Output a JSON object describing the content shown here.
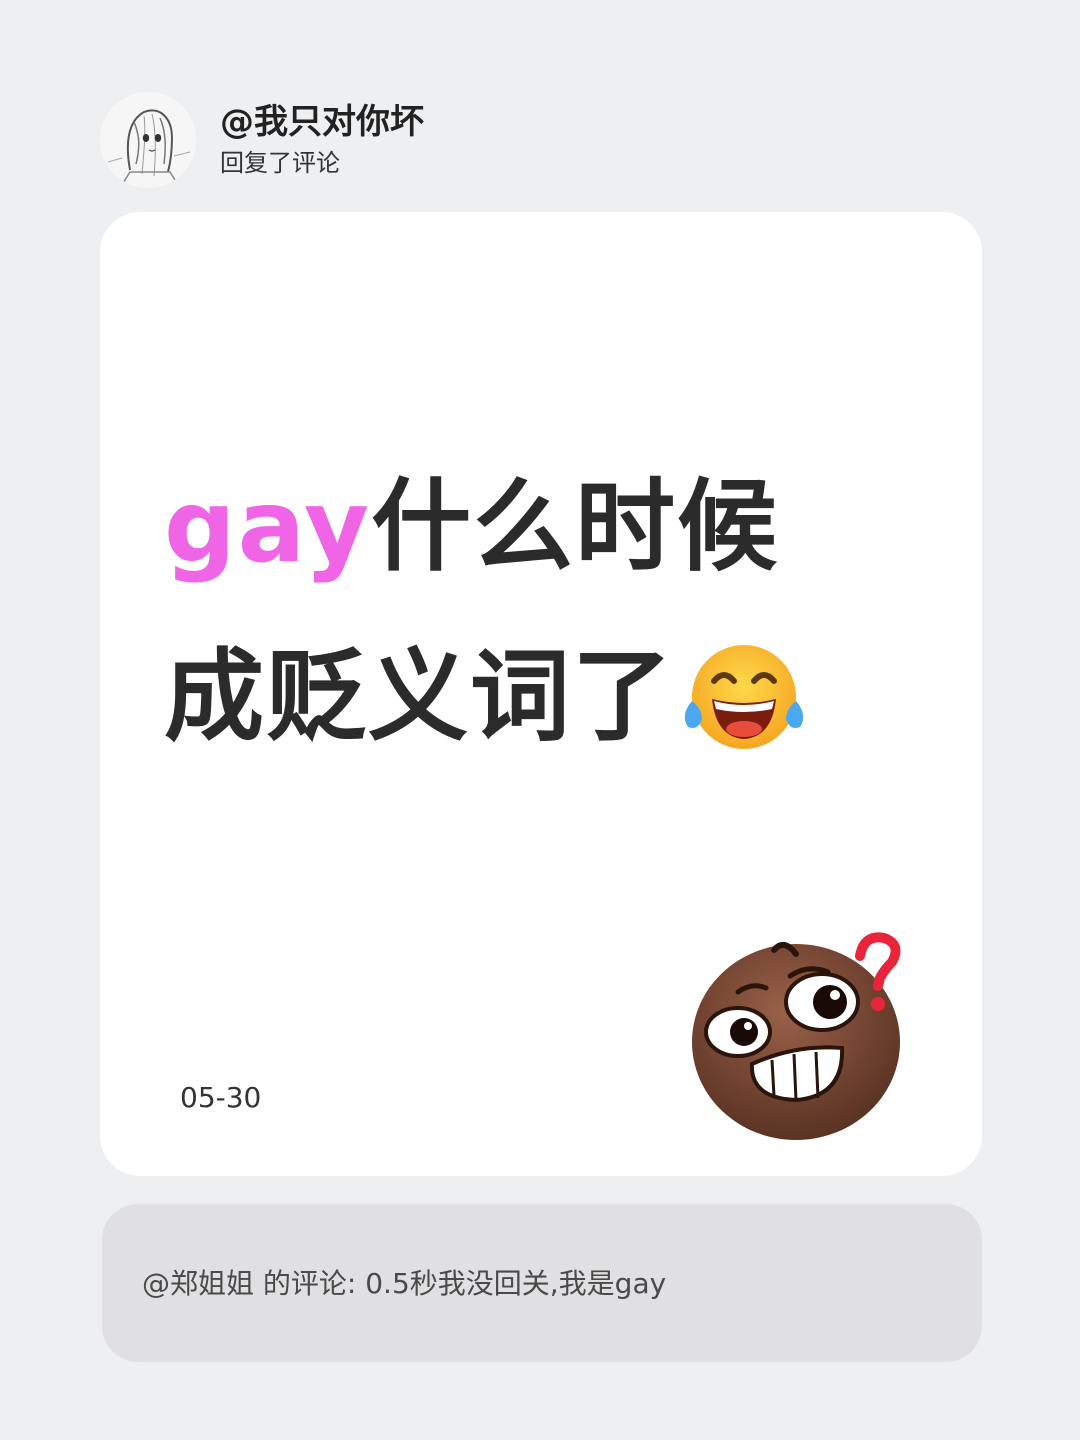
{
  "header": {
    "username": "@我只对你坏",
    "action": "回复了评论",
    "avatar_icon": "anime-girl-sketch-avatar"
  },
  "post": {
    "headline_accent": "gay",
    "headline_rest_line1": "什么时候",
    "headline_line2": "成贬义词了",
    "inline_emoji": "face-with-tears-of-joy-icon",
    "date": "05-30",
    "sticker": "brown-grinning-face-with-question-mark-icon"
  },
  "quoted_comment": {
    "text": "@郑姐姐 的评论: 0.5秒我没回关,我是gay"
  },
  "colors": {
    "background": "#eeeff1",
    "card": "#ffffff",
    "accent_pink": "#f064e6",
    "headline_text": "#2b2b2b",
    "comment_box": "#e0e0e2"
  }
}
